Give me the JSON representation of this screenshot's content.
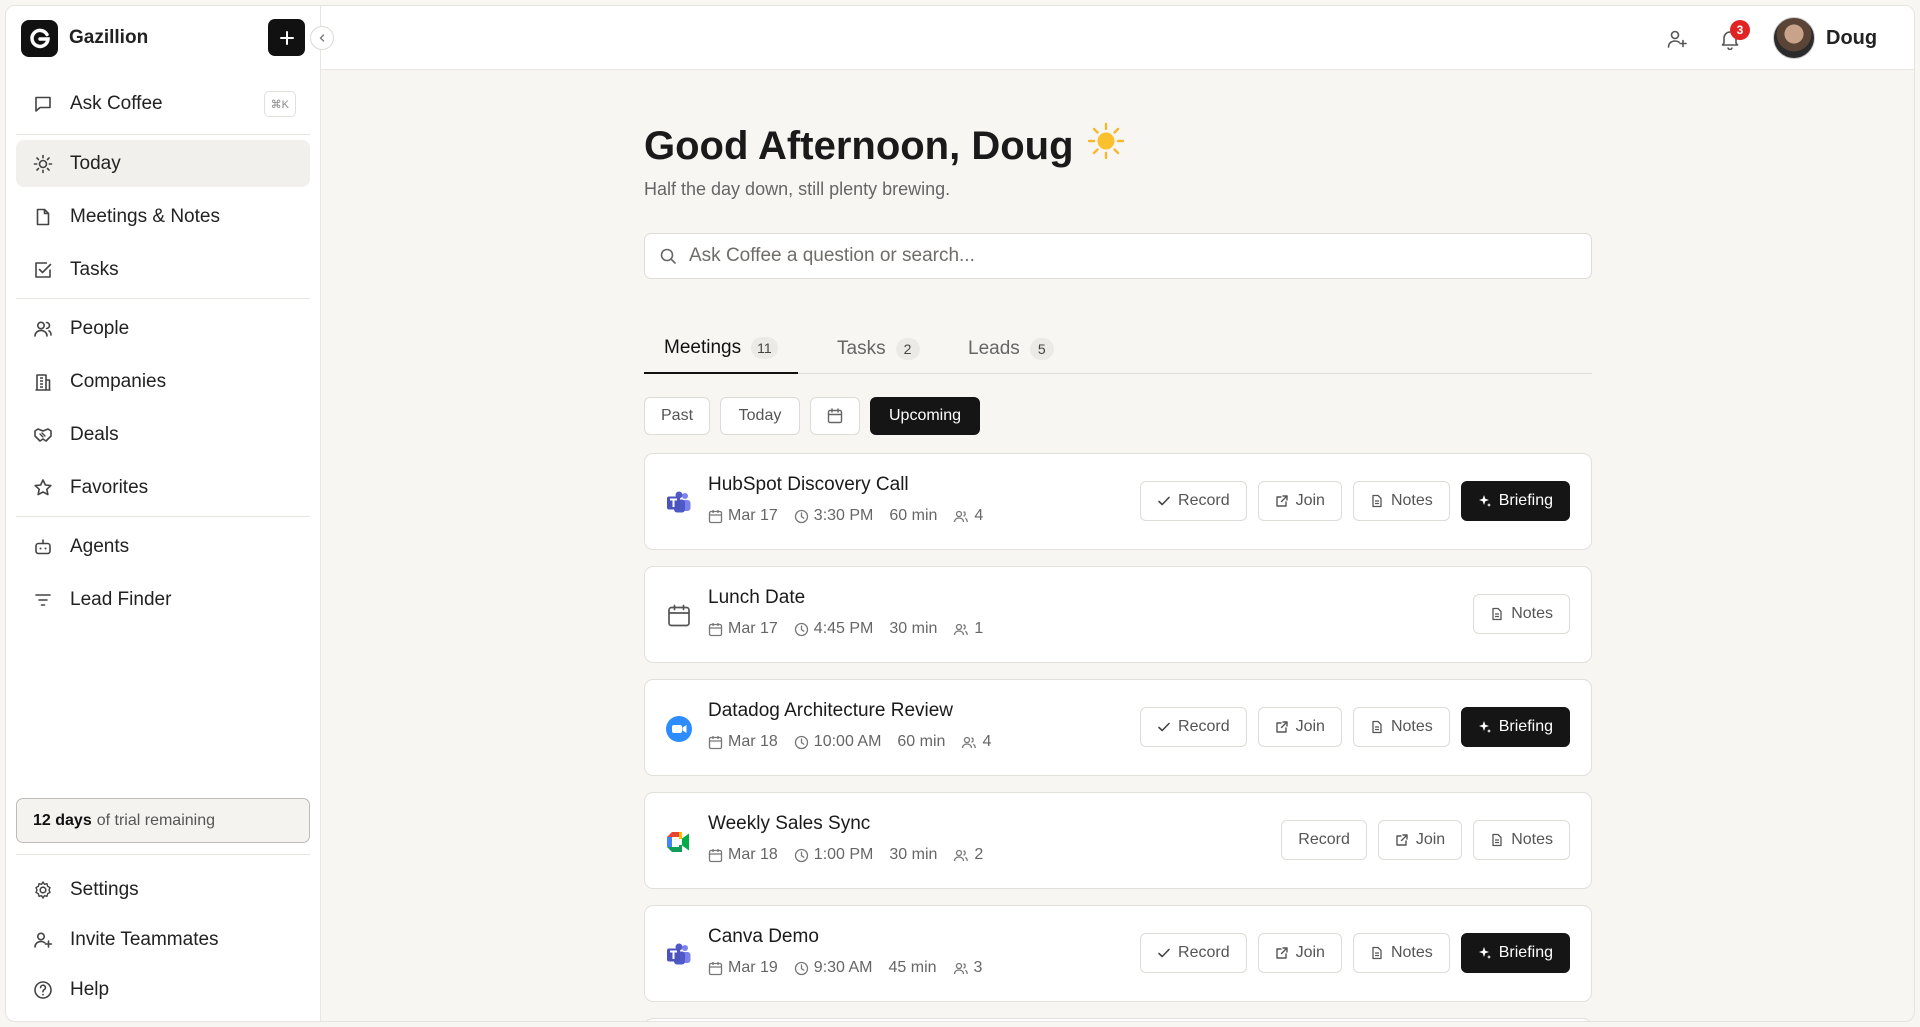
{
  "app": {
    "name": "Gazillion"
  },
  "sidebar": {
    "ask": {
      "label": "Ask Coffee",
      "shortcut": "⌘K"
    },
    "items": [
      {
        "label": "Today",
        "icon": "sun-icon"
      },
      {
        "label": "Meetings & Notes",
        "icon": "file-icon"
      },
      {
        "label": "Tasks",
        "icon": "checkbox-icon"
      },
      {
        "label": "People",
        "icon": "people-icon"
      },
      {
        "label": "Companies",
        "icon": "building-icon"
      },
      {
        "label": "Deals",
        "icon": "handshake-icon"
      },
      {
        "label": "Favorites",
        "icon": "star-icon"
      },
      {
        "label": "Agents",
        "icon": "robot-icon"
      },
      {
        "label": "Lead Finder",
        "icon": "filter-icon"
      }
    ],
    "trial": {
      "days": "12 days",
      "text": "of trial remaining"
    },
    "footer": [
      {
        "label": "Settings",
        "icon": "gear-icon"
      },
      {
        "label": "Invite Teammates",
        "icon": "user-plus-icon"
      },
      {
        "label": "Help",
        "icon": "help-icon"
      }
    ]
  },
  "topbar": {
    "notification_count": "3",
    "user_name": "Doug"
  },
  "main": {
    "greeting": "Good Afternoon, Doug",
    "greeting_emoji": "☀️",
    "subtitle": "Half the day down, still plenty brewing.",
    "search_placeholder": "Ask Coffee a question or search...",
    "tabs": [
      {
        "label": "Meetings",
        "count": "11"
      },
      {
        "label": "Tasks",
        "count": "2"
      },
      {
        "label": "Leads",
        "count": "5"
      }
    ],
    "filters": {
      "past": "Past",
      "today": "Today",
      "upcoming": "Upcoming"
    },
    "actions": {
      "record": "Record",
      "join": "Join",
      "notes": "Notes",
      "briefing": "Briefing"
    },
    "meetings": [
      {
        "title": "HubSpot Discovery Call",
        "date": "Mar 17",
        "time": "3:30 PM",
        "duration": "60 min",
        "attendees": "4",
        "app": "teams-icon"
      },
      {
        "title": "Lunch Date",
        "date": "Mar 17",
        "time": "4:45 PM",
        "duration": "30 min",
        "attendees": "1",
        "app": "calendar-icon"
      },
      {
        "title": "Datadog Architecture Review",
        "date": "Mar 18",
        "time": "10:00 AM",
        "duration": "60 min",
        "attendees": "4",
        "app": "zoom-icon"
      },
      {
        "title": "Weekly Sales Sync",
        "date": "Mar 18",
        "time": "1:00 PM",
        "duration": "30 min",
        "attendees": "2",
        "app": "google-meet-icon"
      },
      {
        "title": "Canva Demo",
        "date": "Mar 19",
        "time": "9:30 AM",
        "duration": "45 min",
        "attendees": "3",
        "app": "teams-icon"
      }
    ]
  }
}
